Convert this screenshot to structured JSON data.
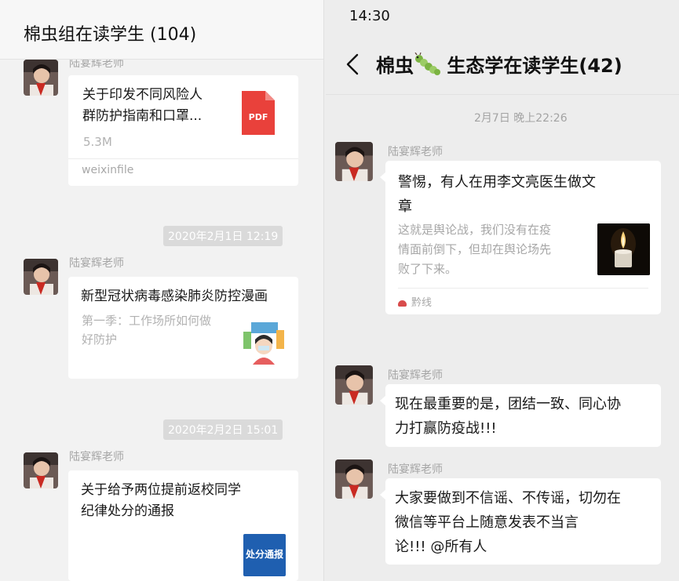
{
  "left": {
    "title": "棉虫组在读学生 (104)",
    "messages": [
      {
        "sender": "陆宴辉老师",
        "card_title_line1": "关于印发不同风险人",
        "card_title_line2": "群防护指南和口罩...",
        "file_size": "5.3M",
        "file_icon": "PDF",
        "source": "weixinfile"
      },
      {
        "timestamp": "2020年2月1日 12:19",
        "sender": "陆宴辉老师",
        "card_title": "新型冠状病毒感染肺炎防控漫画",
        "card_desc_line1": "第一季：工作场所如何做",
        "card_desc_line2": "好防护"
      },
      {
        "timestamp": "2020年2月2日 15:01",
        "sender": "陆宴辉老师",
        "card_title_line1": "关于给予两位提前返校同学",
        "card_title_line2": "纪律处分的通报",
        "thumb_text": "处分通报"
      }
    ]
  },
  "right": {
    "status_time": "14:30",
    "title_prefix": "棉虫",
    "title_suffix": " 生态学在读学生(42)",
    "title_icon": "caterpillar-icon",
    "timestamp": "2月7日 晚上22:26",
    "messages": [
      {
        "sender": "陆宴辉老师",
        "card_title_line1": "警惕，有人在用李文亮医生做文",
        "card_title_line2": "章",
        "desc_line1": "这就是舆论战，我们没有在疫",
        "desc_line2": "情面前倒下，但却在舆论场先",
        "desc_line3": "败了下来。",
        "source": "黔线"
      },
      {
        "sender": "陆宴辉老师",
        "text_line1": "现在最重要的是，团结一致、同心协",
        "text_line2": "力打赢防疫战!!!"
      },
      {
        "sender": "陆宴辉老师",
        "text_line1": "大家要做到不信谣、不传谣，切勿在",
        "text_line2": "微信等平台上随意发表不当言",
        "text_line3": "论!!! @所有人"
      }
    ]
  },
  "colors": {
    "pdf_red": "#e9413b",
    "bubble": "#ffffff",
    "timestamp_pill": "#dadada",
    "source_icon": "#d84b4b"
  }
}
